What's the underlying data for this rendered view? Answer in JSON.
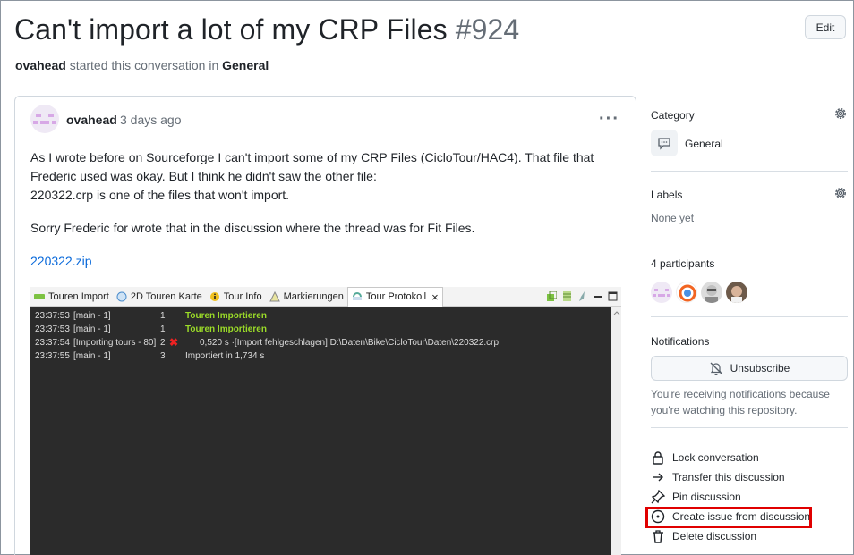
{
  "header": {
    "title": "Can't import a lot of my CRP Files",
    "number": "#924",
    "edit_label": "Edit",
    "author": "ovahead",
    "started_text": "started this conversation in",
    "category": "General"
  },
  "post": {
    "author": "ovahead",
    "time": "3 days ago",
    "more": "···",
    "line1": "As I wrote before on Sourceforge I can't import some of my CRP Files (CicloTour/HAC4). That file that",
    "line2": "Frederic used was okay. But I think he didn't saw the other file:",
    "line3": "220322.crp is one of the files that won't import.",
    "para2": "Sorry Frederic for wrote that in the discussion where the thread was for Fit Files.",
    "attachment": "220322.zip"
  },
  "screenshot": {
    "tabs": [
      "Touren Import",
      "2D Touren Karte",
      "Tour Info",
      "Markierungen",
      "Tour Protokoll"
    ],
    "close": "×",
    "rows": [
      {
        "time": "23:37:53",
        "source": "[main - 1]",
        "num": "1",
        "msg": "Touren Importieren",
        "style": "green"
      },
      {
        "time": "23:37:53",
        "source": "[main - 1]",
        "num": "1",
        "msg": "Touren Importieren",
        "style": "green"
      },
      {
        "time": "23:37:54",
        "source": "[Importing tours - 80]",
        "num": "2",
        "mark": "✖",
        "msg": "0,520 s ·[Import fehlgeschlagen] D:\\Daten\\Bike\\CicloTour\\Daten\\220322.crp",
        "style": "error"
      },
      {
        "time": "23:37:55",
        "source": "[main - 1]",
        "num": "3",
        "msg": "Importiert in 1,734 s",
        "style": "normal"
      }
    ]
  },
  "sidebar": {
    "category_heading": "Category",
    "category_value": "General",
    "labels_heading": "Labels",
    "labels_value": "None yet",
    "participants_heading": "4 participants",
    "notifications_heading": "Notifications",
    "unsubscribe_label": "Unsubscribe",
    "notif_line1": "You're receiving notifications because",
    "notif_line2": "you're watching this repository.",
    "actions": [
      "Lock conversation",
      "Transfer this discussion",
      "Pin discussion",
      "Create issue from discussion",
      "Delete discussion"
    ]
  },
  "colors": {
    "link": "#0969da",
    "highlight_box": "#e00000",
    "console_bg": "#2b2b2b",
    "console_green": "#9bdc28"
  }
}
